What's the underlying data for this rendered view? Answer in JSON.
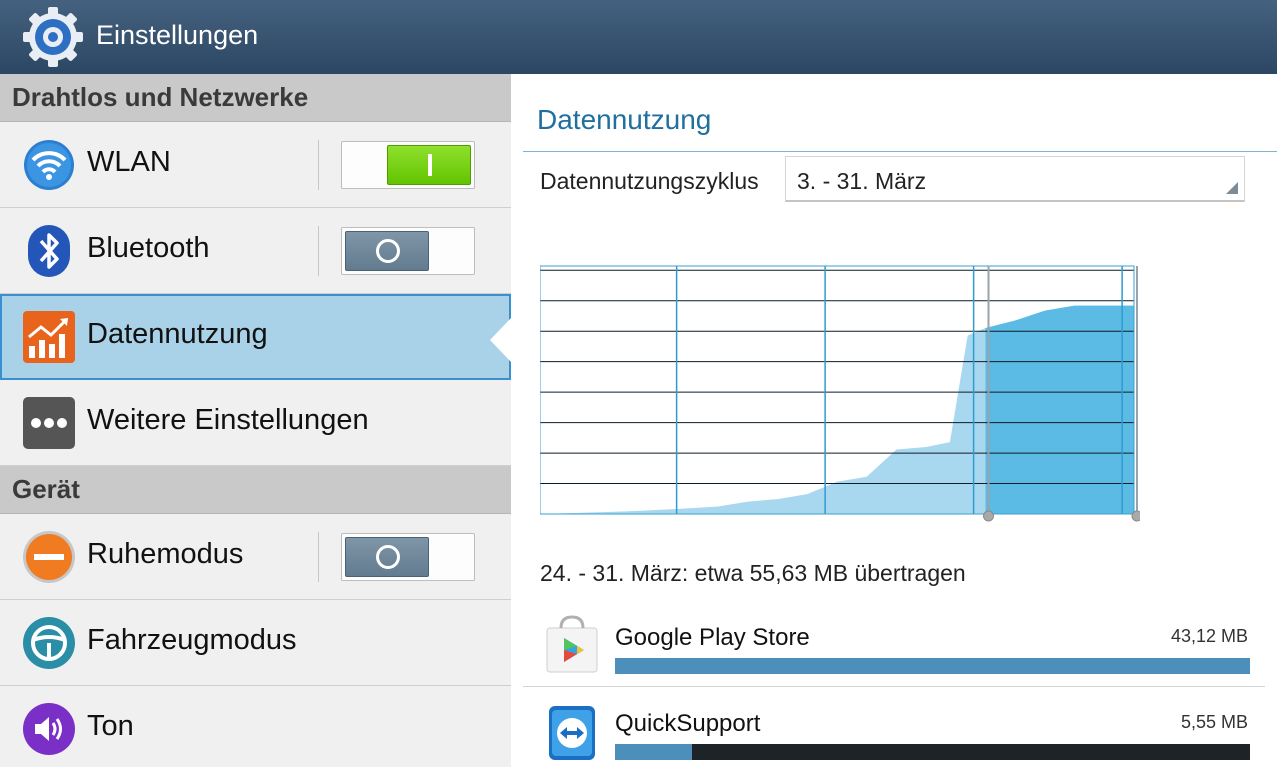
{
  "app_bar": {
    "title": "Einstellungen",
    "icon": "gear-icon"
  },
  "sidebar": {
    "sections": [
      {
        "header": "Drahtlos und Netzwerke",
        "items": [
          {
            "label": "WLAN",
            "icon": "wifi-icon",
            "toggle": "on"
          },
          {
            "label": "Bluetooth",
            "icon": "bluetooth-icon",
            "toggle": "off"
          },
          {
            "label": "Datennutzung",
            "icon": "data-usage-icon",
            "selected": true
          },
          {
            "label": "Weitere Einstellungen",
            "icon": "more-icon"
          }
        ]
      },
      {
        "header": "Gerät",
        "items": [
          {
            "label": "Ruhemodus",
            "icon": "blocking-mode-icon",
            "toggle": "off"
          },
          {
            "label": "Fahrzeugmodus",
            "icon": "steering-wheel-icon"
          },
          {
            "label": "Ton",
            "icon": "speaker-icon"
          }
        ]
      }
    ]
  },
  "detail": {
    "title": "Datennutzung",
    "cycle_label": "Datennutzungszyklus",
    "cycle_value": "3. - 31. März",
    "summary": "24. - 31. März: etwa 55,63 MB übertragen",
    "apps": [
      {
        "name": "Google Play Store",
        "size": "43,12 MB",
        "icon": "play-store-icon",
        "share": 1.0
      },
      {
        "name": "QuickSupport",
        "size": "5,55 MB",
        "icon": "quicksupport-icon",
        "share": 0.121
      }
    ]
  },
  "colors": {
    "accent": "#1f6f9f",
    "chart_fill_light": "#a8d8f0",
    "chart_fill_selected": "#5bbbe4",
    "chart_grid": "#0f1c26",
    "toggle_on": "#70cc10",
    "toggle_off": "#6f889b"
  },
  "chart_data": {
    "type": "area",
    "cumulative": true,
    "x": [
      0,
      0.14,
      0.23,
      0.3,
      0.35,
      0.4,
      0.45,
      0.5,
      0.55,
      0.6,
      0.65,
      0.69,
      0.72,
      0.75,
      0.8,
      0.85,
      0.9,
      1.0
    ],
    "y": [
      0.0,
      0.01,
      0.02,
      0.03,
      0.05,
      0.06,
      0.08,
      0.13,
      0.15,
      0.26,
      0.27,
      0.29,
      0.72,
      0.75,
      0.78,
      0.82,
      0.84,
      0.84
    ],
    "selection": [
      0.75,
      1.0
    ],
    "grid": true
  }
}
